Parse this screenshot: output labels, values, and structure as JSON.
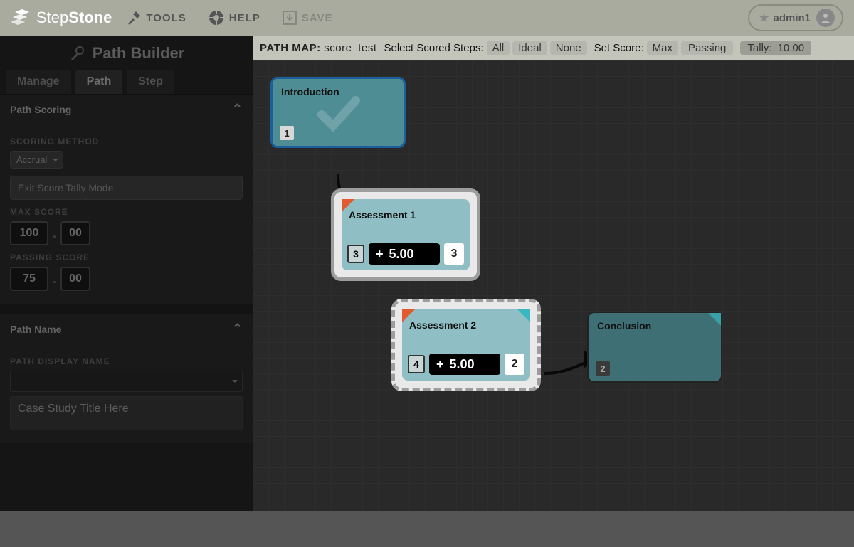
{
  "topbar": {
    "brand_a": "Step",
    "brand_b": "Stone",
    "tools": "TOOLS",
    "help": "HELP",
    "save": "SAVE",
    "username": "admin1"
  },
  "sidebar": {
    "title": "Path Builder",
    "tabs": {
      "manage": "Manage",
      "path": "Path",
      "step": "Step"
    },
    "scoring": {
      "header": "Path Scoring",
      "method_label": "SCORING METHOD",
      "method_value": "Accrual",
      "exit_btn": "Exit Score Tally Mode",
      "max_label": "MAX SCORE",
      "max_int": "100",
      "max_dec": "00",
      "pass_label": "PASSING SCORE",
      "pass_int": "75",
      "pass_dec": "00"
    },
    "pathname": {
      "header": "Path Name",
      "display_label": "PATH DISPLAY NAME",
      "value": "Case Study Title Here"
    }
  },
  "canvas": {
    "pathmap_label": "PATH MAP:",
    "pathmap_name": "score_test",
    "scored_label": "Select Scored Steps:",
    "btn_all": "All",
    "btn_ideal": "Ideal",
    "btn_none": "None",
    "setscore_label": "Set Score:",
    "btn_max": "Max",
    "btn_passing": "Passing",
    "tally_label": "Tally:",
    "tally_value": "10.00",
    "nodes": {
      "intro": {
        "title": "Introduction",
        "num": "1"
      },
      "a1": {
        "title": "Assessment 1",
        "left": "3",
        "sign": "+",
        "score": "5.00",
        "right": "3"
      },
      "a2": {
        "title": "Assessment 2",
        "left": "4",
        "sign": "+",
        "score": "5.00",
        "right": "2"
      },
      "conc": {
        "title": "Conclusion",
        "num": "2"
      }
    }
  }
}
